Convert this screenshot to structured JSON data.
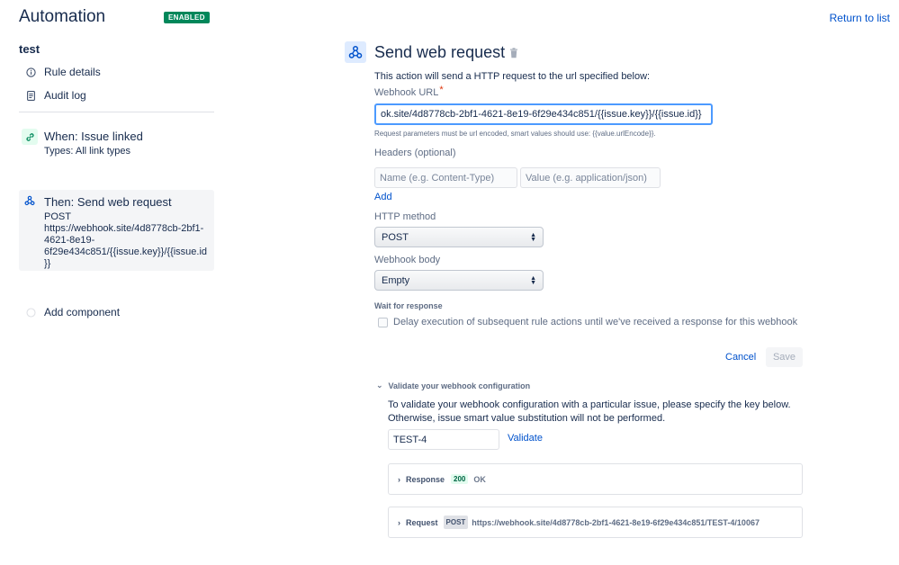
{
  "header": {
    "title": "Automation",
    "status_badge": "ENABLED",
    "return_link": "Return to list"
  },
  "sidebar": {
    "rule_name": "test",
    "nav": [
      {
        "label": "Rule details",
        "icon": "info-icon"
      },
      {
        "label": "Audit log",
        "icon": "document-icon"
      }
    ],
    "trigger": {
      "title": "When: Issue linked",
      "detail": "Types: All link types",
      "icon": "link-icon"
    },
    "action": {
      "title": "Then: Send web request",
      "lines": [
        "POST",
        "https://webhook.site/4d8778cb-2bf1-",
        "4621-8e19-",
        "6f29e434c851/{{issue.key}}/{{issue.id",
        "}}"
      ],
      "icon": "webhook-icon"
    },
    "add_component": "Add component"
  },
  "main": {
    "title": "Send web request",
    "description": "This action will send a HTTP request to the url specified below:",
    "webhook_url": {
      "label": "Webhook URL",
      "required_mark": "*",
      "value": "ok.site/4d8778cb-2bf1-4621-8e19-6f29e434c851/{{issue.key}}/{{issue.id}}",
      "hint": "Request parameters must be url encoded, smart values should use: {{value.urlEncode}}."
    },
    "headers": {
      "label": "Headers (optional)",
      "name_placeholder": "Name (e.g. Content-Type)",
      "value_placeholder": "Value (e.g. application/json)",
      "add_label": "Add"
    },
    "http_method": {
      "label": "HTTP method",
      "selected": "POST"
    },
    "webhook_body": {
      "label": "Webhook body",
      "selected": "Empty"
    },
    "wait": {
      "label": "Wait for response",
      "checkbox_label": "Delay execution of subsequent rule actions until we've received a response for this webhook",
      "checked": false
    },
    "buttons": {
      "cancel": "Cancel",
      "save": "Save"
    },
    "validate": {
      "heading": "Validate your webhook configuration",
      "text": "To validate your webhook configuration with a particular issue, please specify the key below. Otherwise, issue smart value substitution will not be performed.",
      "issue_key": "TEST-4",
      "validate_label": "Validate"
    },
    "response": {
      "label": "Response",
      "status_code": "200",
      "status_text": "OK"
    },
    "request": {
      "label": "Request",
      "method": "POST",
      "url": "https://webhook.site/4d8778cb-2bf1-4621-8e19-6f29e434c851/TEST-4/10067"
    }
  },
  "colors": {
    "accent": "#0052cc",
    "enabled_badge": "#00875a",
    "focus_border": "#4c9aff",
    "required": "#de350b"
  }
}
